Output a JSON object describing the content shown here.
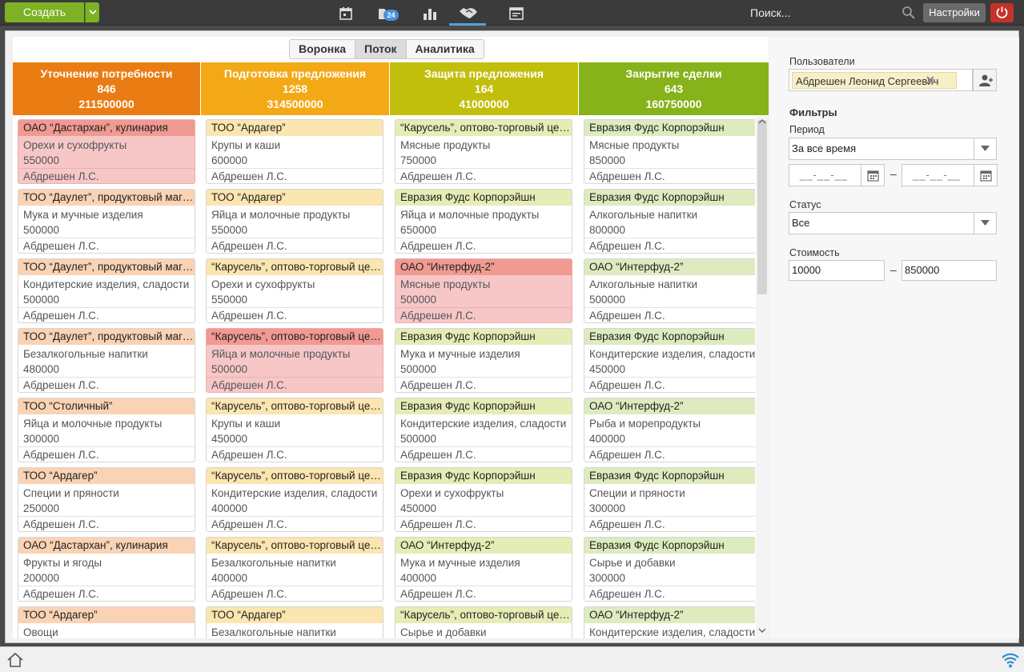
{
  "topbar": {
    "create_label": "Создать",
    "badge_count": "24",
    "search_placeholder": "Поиск...",
    "settings_label": "Настройки",
    "nav_icons": [
      "calendar-icon",
      "folder-icon",
      "bar-chart-icon",
      "handshake-icon",
      "browser-window-icon"
    ]
  },
  "view_tabs": [
    "Воронка",
    "Поток",
    "Аналитика"
  ],
  "active_view_tab": "Поток",
  "columns": [
    {
      "title": "Уточнение потребности",
      "count": "846",
      "sum": "211500000",
      "color": "#ea7c14"
    },
    {
      "title": "Подготовка предложения",
      "count": "1258",
      "sum": "314500000",
      "color": "#f3a916"
    },
    {
      "title": "Защита предложения",
      "count": "164",
      "sum": "41000000",
      "color": "#c2be0c"
    },
    {
      "title": "Закрытие сделки",
      "count": "643",
      "sum": "160750000",
      "color": "#86b21a"
    }
  ],
  "card_colors": {
    "col0": "#fad3b5",
    "col1": "#fbe5b0",
    "col2": "#e6ecb5",
    "col3": "#ddebbf",
    "hot": "#f19a92"
  },
  "cards": [
    [
      {
        "company": "ОАО “Дастархан”, кулинария",
        "product": "Орехи и сухофрукты",
        "amount": "550000",
        "owner": "Абдрешен Л.С.",
        "hot": true
      },
      {
        "company": "ТОО “Даулет”, продуктовый магазин",
        "product": "Мука и мучные изделия",
        "amount": "500000",
        "owner": "Абдрешен Л.С."
      },
      {
        "company": "ТОО “Даулет”, продуктовый магазин",
        "product": "Кондитерские изделия, сладости",
        "amount": "500000",
        "owner": "Абдрешен Л.С."
      },
      {
        "company": "ТОО “Даулет”, продуктовый магазин",
        "product": "Безалкогольные напитки",
        "amount": "480000",
        "owner": "Абдрешен Л.С."
      },
      {
        "company": "ТОО “Столичный”",
        "product": "Яйца и молочные продукты",
        "amount": "300000",
        "owner": "Абдрешен Л.С."
      },
      {
        "company": "ТОО “Ардагер”",
        "product": "Специи и пряности",
        "amount": "250000",
        "owner": "Абдрешен Л.С."
      },
      {
        "company": "ОАО “Дастархан”, кулинария",
        "product": "Фрукты и ягоды",
        "amount": "200000",
        "owner": "Абдрешен Л.С."
      },
      {
        "company": "ТОО “Ардагер”",
        "product": "Овощи",
        "amount": "",
        "owner": ""
      }
    ],
    [
      {
        "company": "ТОО “Ардагер”",
        "product": "Крупы и каши",
        "amount": "600000",
        "owner": "Абдрешен Л.С."
      },
      {
        "company": "ТОО “Ардагер”",
        "product": "Яйца и молочные продукты",
        "amount": "550000",
        "owner": "Абдрешен Л.С."
      },
      {
        "company": "“Карусель”, оптово-торговый центр",
        "product": "Орехи и сухофрукты",
        "amount": "550000",
        "owner": "Абдрешен Л.С."
      },
      {
        "company": "“Карусель”, оптово-торговый центр",
        "product": "Яйца и молочные продукты",
        "amount": "500000",
        "owner": "Абдрешен Л.С.",
        "hot": true
      },
      {
        "company": "“Карусель”, оптово-торговый центр",
        "product": "Крупы и каши",
        "amount": "450000",
        "owner": "Абдрешен Л.С."
      },
      {
        "company": "“Карусель”, оптово-торговый центр",
        "product": "Кондитерские изделия, сладости",
        "amount": "400000",
        "owner": "Абдрешен Л.С."
      },
      {
        "company": "“Карусель”, оптово-торговый центр",
        "product": "Безалкогольные напитки",
        "amount": "400000",
        "owner": "Абдрешен Л.С."
      },
      {
        "company": "ТОО “Ардагер”",
        "product": "Безалкогольные напитки",
        "amount": "",
        "owner": ""
      }
    ],
    [
      {
        "company": "“Карусель”, оптово-торговый центр",
        "product": "Мясные продукты",
        "amount": "750000",
        "owner": "Абдрешен Л.С."
      },
      {
        "company": "Евразия Фудс Корпорэйшн",
        "product": "Яйца и молочные продукты",
        "amount": "650000",
        "owner": "Абдрешен Л.С."
      },
      {
        "company": "ОАО “Интерфуд-2”",
        "product": "Мясные продукты",
        "amount": "500000",
        "owner": "Абдрешен Л.С.",
        "hot": true
      },
      {
        "company": "Евразия Фудс Корпорэйшн",
        "product": "Мука и мучные изделия",
        "amount": "500000",
        "owner": "Абдрешен Л.С."
      },
      {
        "company": "Евразия Фудс Корпорэйшн",
        "product": "Кондитерские изделия, сладости",
        "amount": "500000",
        "owner": "Абдрешен Л.С."
      },
      {
        "company": "Евразия Фудс Корпорэйшн",
        "product": "Орехи и сухофрукты",
        "amount": "450000",
        "owner": "Абдрешен Л.С."
      },
      {
        "company": "ОАО “Интерфуд-2”",
        "product": "Мука и мучные изделия",
        "amount": "400000",
        "owner": "Абдрешен Л.С."
      },
      {
        "company": "“Карусель”, оптово-торговый центр",
        "product": "Сырье и добавки",
        "amount": "",
        "owner": ""
      }
    ],
    [
      {
        "company": "Евразия Фудс Корпорэйшн",
        "product": "Мясные продукты",
        "amount": "850000",
        "owner": "Абдрешен Л.С."
      },
      {
        "company": "Евразия Фудс Корпорэйшн",
        "product": "Алкогольные напитки",
        "amount": "800000",
        "owner": "Абдрешен Л.С."
      },
      {
        "company": "ОАО “Интерфуд-2”",
        "product": "Алкогольные напитки",
        "amount": "500000",
        "owner": "Абдрешен Л.С."
      },
      {
        "company": "Евразия Фудс Корпорэйшн",
        "product": "Кондитерские изделия, сладости",
        "amount": "450000",
        "owner": "Абдрешен Л.С."
      },
      {
        "company": "ОАО “Интерфуд-2”",
        "product": "Рыба и морепродукты",
        "amount": "400000",
        "owner": "Абдрешен Л.С."
      },
      {
        "company": "Евразия Фудс Корпорэйшн",
        "product": "Специи и пряности",
        "amount": "300000",
        "owner": "Абдрешен Л.С."
      },
      {
        "company": "Евразия Фудс Корпорэйшн",
        "product": "Сырье и добавки",
        "amount": "300000",
        "owner": "Абдрешен Л.С."
      },
      {
        "company": "ОАО “Интерфуд-2”",
        "product": "Кондитерские изделия, сладости",
        "amount": "",
        "owner": ""
      }
    ]
  ],
  "sidebar": {
    "users_label": "Пользователи",
    "user_tag": "Абдрешен Леонид Сергеевич",
    "filters_label": "Фильтры",
    "period_label": "Период",
    "period_value": "За все время",
    "date_from_placeholder": "__-__-__",
    "date_to_placeholder": "__-__-__",
    "date_dash": "–",
    "status_label": "Статус",
    "status_value": "Все",
    "cost_label": "Стоимость",
    "cost_from": "10000",
    "cost_to": "850000",
    "cost_dash": "–"
  }
}
